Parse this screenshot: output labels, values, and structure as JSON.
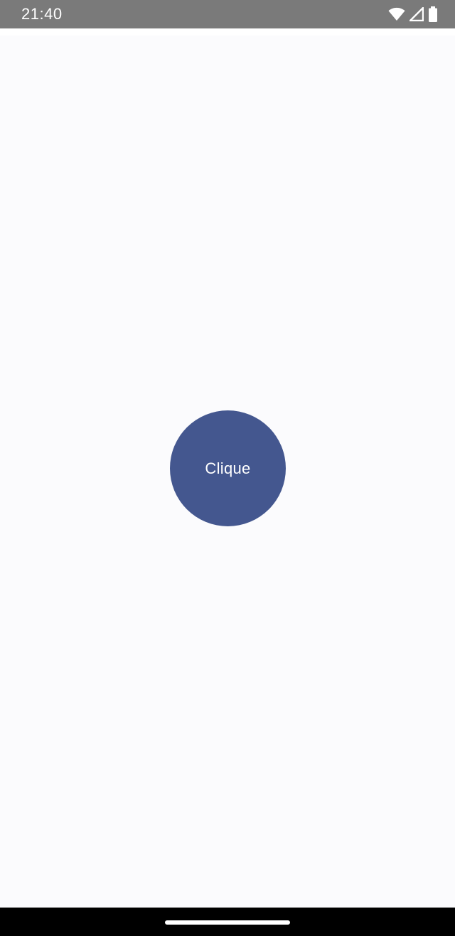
{
  "status_bar": {
    "time": "21:40",
    "icons": [
      "wifi-icon",
      "cell-signal-icon",
      "battery-icon"
    ],
    "background": "#7a7a7a"
  },
  "main": {
    "button_label": "Clique",
    "button_color": "#44578f"
  },
  "nav_bar": {
    "background": "#000000",
    "home_indicator_color": "#ffffff"
  }
}
